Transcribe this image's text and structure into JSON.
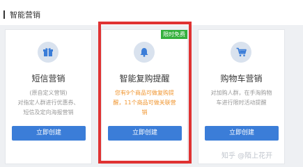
{
  "section": {
    "title": "智能营销"
  },
  "cards": [
    {
      "icon": "gift-icon",
      "title": "短信营销",
      "desc_line1": "(原自定义营销)",
      "desc_line2": "对指定人群进行优惠券、",
      "desc_line3": "短信及定向海报营销",
      "button": "立即创建"
    },
    {
      "icon": "bell-icon",
      "title": "智能复购提醒",
      "badge": "限时免费",
      "desc_line1": "您有9个商品可做复购提",
      "desc_line2": "醒，11个商品可做关联营",
      "desc_line3": "销",
      "button": "立即创建"
    },
    {
      "icon": "cart-icon",
      "title": "购物车营销",
      "desc_line1": "对加购人群，在手淘购物",
      "desc_line2": "车进行限时活动提醒",
      "button": "立即创建"
    }
  ],
  "watermark": "知乎 @陌上花开",
  "colors": {
    "accent": "#3b7dd8",
    "highlight_border": "#e03232",
    "badge": "#34b03c",
    "orange_text": "#f0952f"
  }
}
